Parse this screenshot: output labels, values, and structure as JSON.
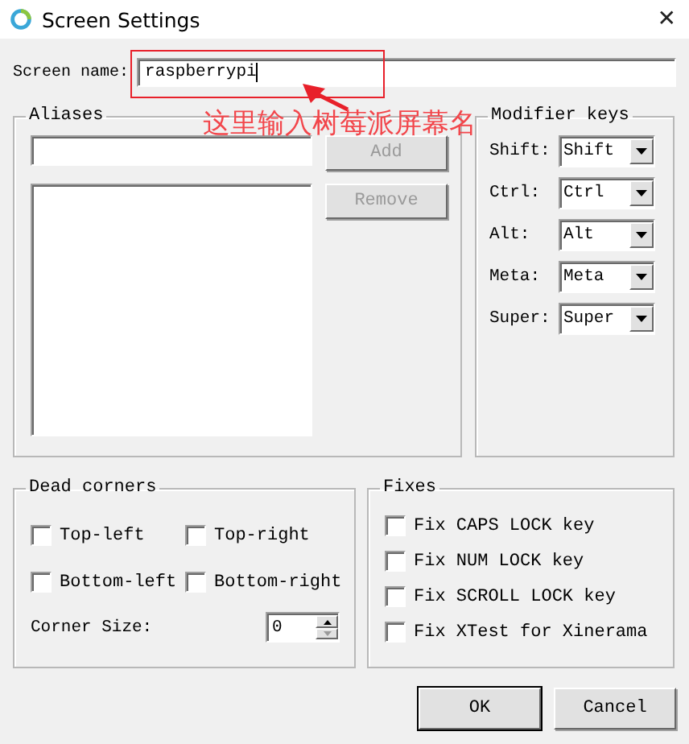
{
  "window": {
    "title": "Screen Settings",
    "close": "✕"
  },
  "screen_name": {
    "label": "Screen name:",
    "value": "raspberrypi"
  },
  "aliases": {
    "title": "Aliases",
    "buttons": [
      {
        "label": "Add",
        "disabled": true
      },
      {
        "label": "Remove",
        "disabled": true
      }
    ]
  },
  "modifier_keys": {
    "title": "Modifier keys",
    "rows": [
      {
        "label": "Shift:",
        "value": "Shift"
      },
      {
        "label": "Ctrl:",
        "value": "Ctrl"
      },
      {
        "label": "Alt:",
        "value": "Alt"
      },
      {
        "label": "Meta:",
        "value": "Meta"
      },
      {
        "label": "Super:",
        "value": "Super"
      }
    ]
  },
  "dead_corners": {
    "title": "Dead corners",
    "corners": [
      {
        "label": "Top-left",
        "checked": false
      },
      {
        "label": "Top-right",
        "checked": false
      },
      {
        "label": "Bottom-left",
        "checked": false
      },
      {
        "label": "Bottom-right",
        "checked": false
      }
    ],
    "corner_size": {
      "label": "Corner Size:",
      "value": "0"
    }
  },
  "fixes": {
    "title": "Fixes",
    "items": [
      {
        "label": "Fix CAPS LOCK key",
        "checked": false
      },
      {
        "label": "Fix NUM LOCK key",
        "checked": false
      },
      {
        "label": "Fix SCROLL LOCK key",
        "checked": false
      },
      {
        "label": "Fix XTest for Xinerama",
        "checked": false
      }
    ]
  },
  "buttons": [
    {
      "label": "OK",
      "default": true
    },
    {
      "label": "Cancel",
      "default": false
    }
  ],
  "annotation": {
    "text": "这里输入树莓派屏幕名"
  }
}
